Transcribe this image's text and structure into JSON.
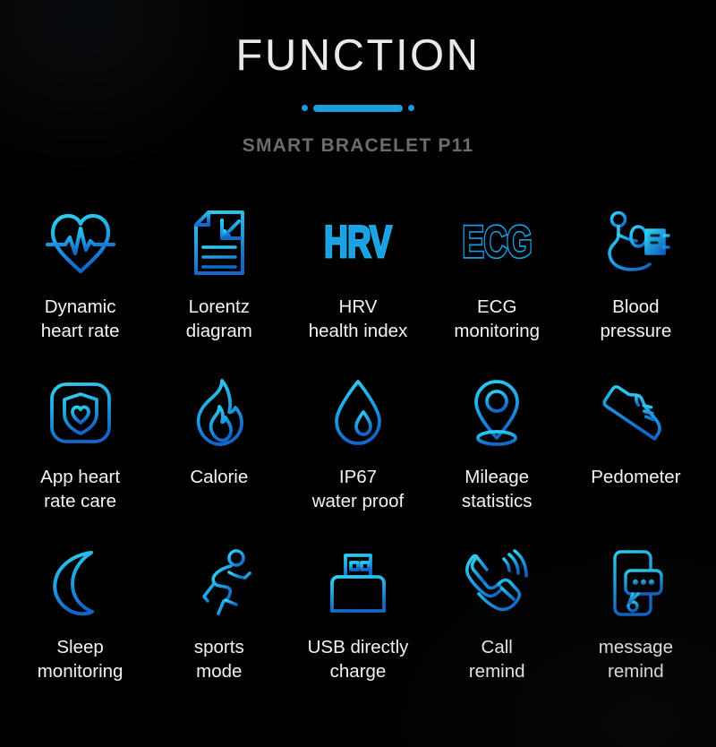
{
  "header": {
    "title": "FUNCTION",
    "subtitle": "SMART BRACELET P11",
    "divider_icon": "dot-bar-dot-divider"
  },
  "theme": {
    "background": "#000000",
    "title_color": "#e9eaec",
    "subtitle_color": "#6a6c70",
    "accent": "#1c9de0",
    "icon_gradient_from": "#2ac8ea",
    "icon_gradient_to": "#1473cf",
    "label_color": "#f2f3f4"
  },
  "features": [
    {
      "id": "dynamic-heart-rate",
      "icon": "heart-pulse-icon",
      "label": "Dynamic\nheart rate"
    },
    {
      "id": "lorentz-diagram",
      "icon": "document-chart-icon",
      "label": "Lorentz\ndiagram"
    },
    {
      "id": "hrv-health-index",
      "icon": "hrv-lettermark-icon",
      "icon_text": "HRV",
      "label": "HRV\nhealth index"
    },
    {
      "id": "ecg-monitoring",
      "icon": "ecg-lettermark-icon",
      "icon_text": "ECG",
      "label": "ECG\nmonitoring"
    },
    {
      "id": "blood-pressure",
      "icon": "sphygmomanometer-icon",
      "label": "Blood\npressure"
    },
    {
      "id": "app-heart-rate-care",
      "icon": "shield-heart-app-icon",
      "label": "App heart\nrate care"
    },
    {
      "id": "calorie",
      "icon": "flame-icon",
      "label": "Calorie"
    },
    {
      "id": "ip67-water-proof",
      "icon": "water-drop-icon",
      "label": "IP67\nwater proof"
    },
    {
      "id": "mileage-statistics",
      "icon": "map-pin-icon",
      "label": "Mileage\nstatistics"
    },
    {
      "id": "pedometer",
      "icon": "sneaker-icon",
      "label": "Pedometer"
    },
    {
      "id": "sleep-monitoring",
      "icon": "crescent-moon-icon",
      "label": "Sleep\nmonitoring"
    },
    {
      "id": "sports-mode",
      "icon": "running-person-icon",
      "label": "sports\nmode"
    },
    {
      "id": "usb-directly-charge",
      "icon": "usb-connector-icon",
      "label": "USB directly\ncharge"
    },
    {
      "id": "call-remind",
      "icon": "phone-ringing-icon",
      "label": "Call\nremind"
    },
    {
      "id": "message-remind",
      "icon": "phone-message-icon",
      "label": "message\nremind"
    }
  ]
}
